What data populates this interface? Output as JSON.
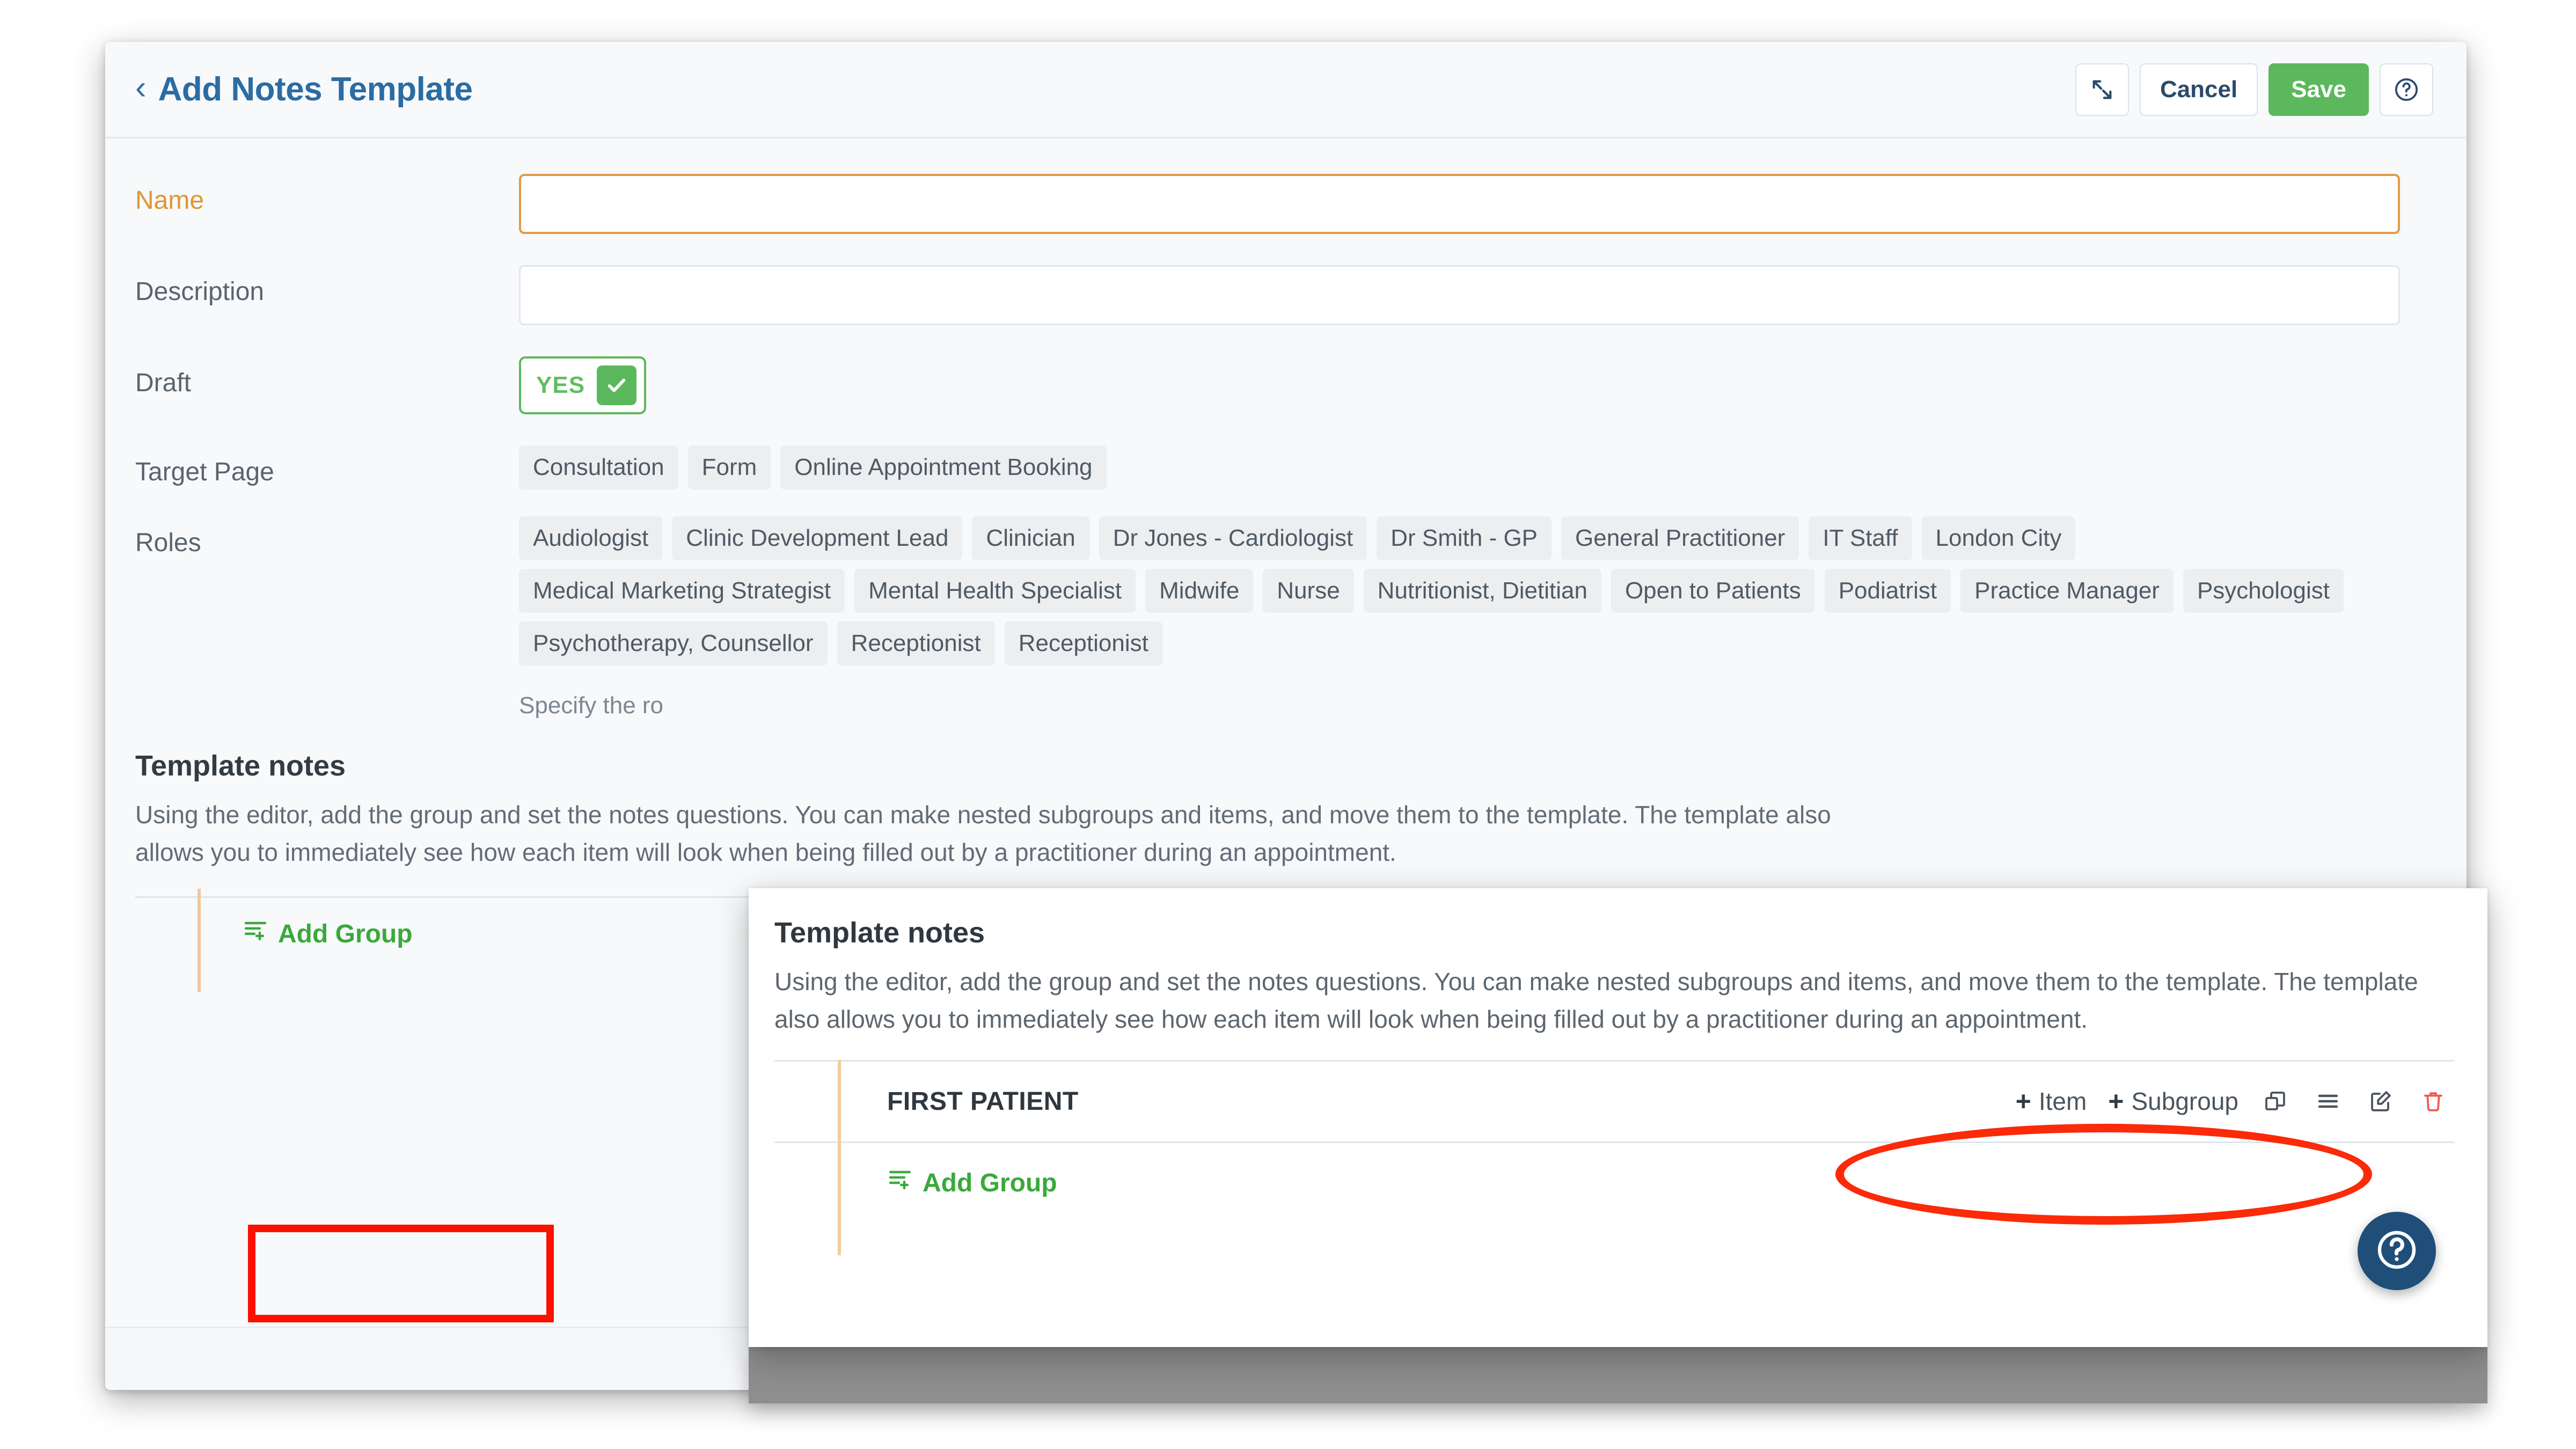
{
  "header": {
    "back_icon": "chevron-left-icon",
    "title": "Add Notes Template",
    "expand_icon": "expand-arrows-icon",
    "cancel_label": "Cancel",
    "save_label": "Save",
    "help_icon": "question-circle-icon"
  },
  "form": {
    "name": {
      "label": "Name",
      "value": "",
      "placeholder": ""
    },
    "description": {
      "label": "Description",
      "value": "",
      "placeholder": ""
    },
    "draft": {
      "label": "Draft",
      "toggle_value": "YES",
      "checked": true
    },
    "target_page": {
      "label": "Target Page",
      "options": [
        "Consultation",
        "Form",
        "Online Appointment Booking"
      ]
    },
    "roles": {
      "label": "Roles",
      "options": [
        "Audiologist",
        "Clinic Development Lead",
        "Clinician",
        "Dr Jones - Cardiologist",
        "Dr Smith - GP",
        "General Practitioner",
        "IT Staff",
        "London City",
        "Medical Marketing Strategist",
        "Mental Health Specialist",
        "Midwife",
        "Nurse",
        "Nutritionist, Dietitian",
        "Open to Patients",
        "Podiatrist",
        "Practice Manager",
        "Psychologist",
        "Psychotherapy, Counsellor",
        "Receptionist",
        "Receptionist"
      ],
      "hint": "Specify the ro"
    }
  },
  "template_notes": {
    "title": "Template notes",
    "description": "Using the editor, add the group and set the notes questions. You can make nested subgroups and items, and move them to the template. The template also allows you to immediately see how each item will look when being filled out by a practitioner during an appointment.",
    "description_clipped": "Using the editor, add the group and set the\nyou to immediately see how each item will",
    "add_group_label": "Add Group",
    "add_group_icon": "list-plus-icon"
  },
  "overlay": {
    "title": "Template notes",
    "description": "Using the editor, add the group and set the notes questions. You can make nested subgroups and items, and move them to the template. The template also allows you to immediately see how each item will look when being filled out by a practitioner during an appointment.",
    "group": {
      "name": "FIRST PATIENT",
      "add_item_label": "Item",
      "add_subgroup_label": "Subgroup",
      "plus_glyph": "+",
      "copy_icon": "copy-icon",
      "drag_icon": "drag-handle-icon",
      "edit_icon": "edit-pencil-icon",
      "delete_icon": "trash-icon"
    },
    "add_group_label": "Add Group",
    "add_group_icon": "list-plus-icon"
  },
  "fab": {
    "icon": "question-circle-icon"
  },
  "annotations": {
    "add_group_rect": "red-rectangle-highlight",
    "item_subgroup_oval": "red-oval-highlight"
  },
  "colors": {
    "brand_blue": "#2b6ca3",
    "save_green": "#5cb85c",
    "link_green": "#3aa93a",
    "required_orange": "#e0962f",
    "input_invalid_border": "#e39a48",
    "annotation_red": "#fc1000",
    "fab_navy": "#1f4e79",
    "delete_red": "#ef5b53",
    "chip_bg": "#eceef0",
    "tree_line": "#f0c79a"
  }
}
